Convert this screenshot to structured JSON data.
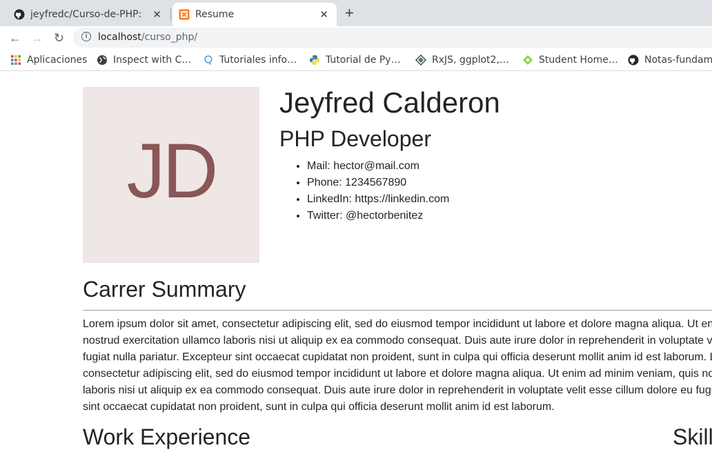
{
  "browser": {
    "tabs": [
      {
        "title": "jeyfredc/Curso-de-PHP: Cu",
        "icon": "github-icon",
        "active": false
      },
      {
        "title": "Resume",
        "icon": "xampp-icon",
        "active": true
      }
    ],
    "new_tab_label": "+",
    "url_host": "localhost",
    "url_path": "/curso_php/",
    "bookmarks": [
      {
        "label": "Aplicaciones",
        "icon": "apps-grid-icon"
      },
      {
        "label": "Inspect with C…",
        "icon": "globe-icon"
      },
      {
        "label": "Tutoriales info…",
        "icon": "q-icon"
      },
      {
        "label": "Tutorial de Py…",
        "icon": "python-icon"
      },
      {
        "label": "RxJS, ggplot2,…",
        "icon": "diamond-icon"
      },
      {
        "label": "Student Home…",
        "icon": "gem-icon"
      },
      {
        "label": "Notas-fundam",
        "icon": "github-icon"
      }
    ]
  },
  "resume": {
    "initials": "JD",
    "name": "Jeyfred Calderon",
    "role": "PHP Developer",
    "contact": [
      "Mail: hector@mail.com",
      "Phone: 1234567890",
      "LinkedIn: https://linkedin.com",
      "Twitter: @hectorbenitez"
    ],
    "summary_title": "Carrer Summary",
    "summary_lines": [
      "Lorem ipsum dolor sit amet, consectetur adipiscing elit, sed do eiusmod tempor incididunt ut labore et dolore magna aliqua. Ut enim ad minim veniam, quis",
      "nostrud exercitation ullamco laboris nisi ut aliquip ex ea commodo consequat. Duis aute irure dolor in reprehenderit in voluptate velit esse cillum dolore eu",
      "fugiat nulla pariatur. Excepteur sint occaecat cupidatat non proident, sunt in culpa qui officia deserunt mollit anim id est laborum. Lorem ipsum dolor sit amet,",
      "consectetur adipiscing elit, sed do eiusmod tempor incididunt ut labore et dolore magna aliqua. Ut enim ad minim veniam, quis nostrud exercitation ullamco",
      "laboris nisi ut aliquip ex ea commodo consequat. Duis aute irure dolor in reprehenderit in voluptate velit esse cillum dolore eu fugiat nulla pariatur. Excepteur",
      "sint occaecat cupidatat non proident, sunt in culpa qui officia deserunt mollit anim id est laborum."
    ],
    "work_title": "Work Experience",
    "skills_title": "Skills"
  }
}
